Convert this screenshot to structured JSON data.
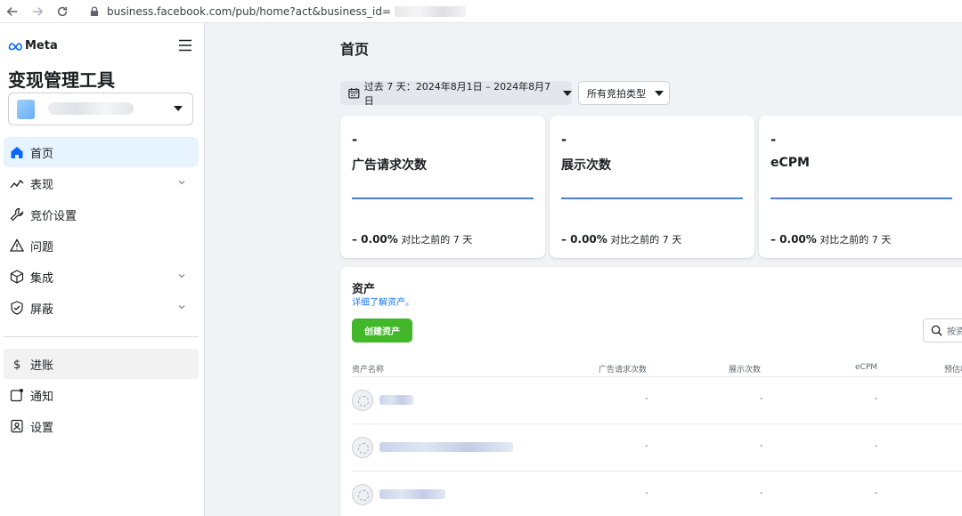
{
  "browser": {
    "url": "business.facebook.com/pub/home?act&business_id="
  },
  "sidebar": {
    "brand": "Meta",
    "app_title": "变现管理工具",
    "items": [
      {
        "label": "首页",
        "icon": "home-icon",
        "active": true,
        "chevron": false
      },
      {
        "label": "表现",
        "icon": "trend-icon",
        "active": false,
        "chevron": true
      },
      {
        "label": "竞价设置",
        "icon": "wrench-icon",
        "active": false,
        "chevron": false
      },
      {
        "label": "问题",
        "icon": "warning-icon",
        "active": false,
        "chevron": false
      },
      {
        "label": "集成",
        "icon": "cube-icon",
        "active": false,
        "chevron": true
      },
      {
        "label": "屏蔽",
        "icon": "shield-icon",
        "active": false,
        "chevron": true
      }
    ],
    "items2": [
      {
        "label": "进账",
        "icon": "dollar-icon"
      },
      {
        "label": "通知",
        "icon": "notification-icon"
      },
      {
        "label": "设置",
        "icon": "settings-icon"
      }
    ]
  },
  "main": {
    "page_title": "首页",
    "date_filter": "过去 7 天：2024年8月1日 – 2024年8月7日",
    "type_filter": "所有竞拍类型",
    "metrics": [
      {
        "value": "-",
        "label": "广告请求次数",
        "change": "– 0.00%",
        "compare": "对比之前的 7 天"
      },
      {
        "value": "-",
        "label": "展示次数",
        "change": "– 0.00%",
        "compare": "对比之前的 7 天"
      },
      {
        "value": "-",
        "label": "eCPM",
        "change": "– 0.00%",
        "compare": "对比之前的 7 天"
      }
    ],
    "assets": {
      "title": "资产",
      "learn_more": "详细了解资产。",
      "create_button": "创建资产",
      "search_placeholder": "按资",
      "columns": [
        "资产名称",
        "广告请求次数",
        "展示次数",
        "eCPM",
        "预估收"
      ],
      "rows": [
        {
          "requests": "-",
          "impressions": "-",
          "ecpm": "-"
        },
        {
          "requests": "-",
          "impressions": "-",
          "ecpm": "-"
        },
        {
          "requests": "-",
          "impressions": "-",
          "ecpm": "-"
        }
      ]
    }
  },
  "colors": {
    "accent": "#1877f2",
    "create_button": "#42b72a",
    "active_nav": "#e7f3ff",
    "metric_line": "#4a7bd8"
  }
}
